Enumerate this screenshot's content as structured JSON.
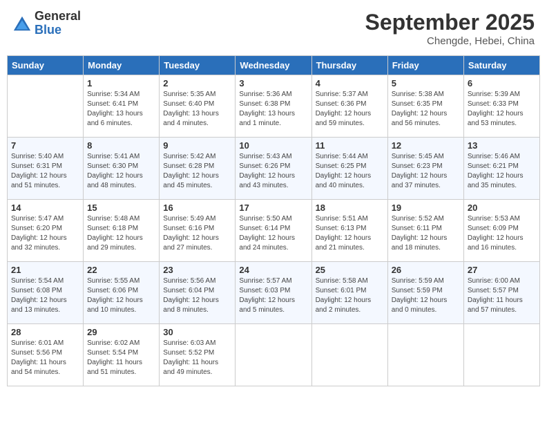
{
  "header": {
    "logo_general": "General",
    "logo_blue": "Blue",
    "month_title": "September 2025",
    "subtitle": "Chengde, Hebei, China"
  },
  "weekdays": [
    "Sunday",
    "Monday",
    "Tuesday",
    "Wednesday",
    "Thursday",
    "Friday",
    "Saturday"
  ],
  "weeks": [
    [
      {
        "day": "",
        "sunrise": "",
        "sunset": "",
        "daylight": ""
      },
      {
        "day": "1",
        "sunrise": "Sunrise: 5:34 AM",
        "sunset": "Sunset: 6:41 PM",
        "daylight": "Daylight: 13 hours and 6 minutes."
      },
      {
        "day": "2",
        "sunrise": "Sunrise: 5:35 AM",
        "sunset": "Sunset: 6:40 PM",
        "daylight": "Daylight: 13 hours and 4 minutes."
      },
      {
        "day": "3",
        "sunrise": "Sunrise: 5:36 AM",
        "sunset": "Sunset: 6:38 PM",
        "daylight": "Daylight: 13 hours and 1 minute."
      },
      {
        "day": "4",
        "sunrise": "Sunrise: 5:37 AM",
        "sunset": "Sunset: 6:36 PM",
        "daylight": "Daylight: 12 hours and 59 minutes."
      },
      {
        "day": "5",
        "sunrise": "Sunrise: 5:38 AM",
        "sunset": "Sunset: 6:35 PM",
        "daylight": "Daylight: 12 hours and 56 minutes."
      },
      {
        "day": "6",
        "sunrise": "Sunrise: 5:39 AM",
        "sunset": "Sunset: 6:33 PM",
        "daylight": "Daylight: 12 hours and 53 minutes."
      }
    ],
    [
      {
        "day": "7",
        "sunrise": "Sunrise: 5:40 AM",
        "sunset": "Sunset: 6:31 PM",
        "daylight": "Daylight: 12 hours and 51 minutes."
      },
      {
        "day": "8",
        "sunrise": "Sunrise: 5:41 AM",
        "sunset": "Sunset: 6:30 PM",
        "daylight": "Daylight: 12 hours and 48 minutes."
      },
      {
        "day": "9",
        "sunrise": "Sunrise: 5:42 AM",
        "sunset": "Sunset: 6:28 PM",
        "daylight": "Daylight: 12 hours and 45 minutes."
      },
      {
        "day": "10",
        "sunrise": "Sunrise: 5:43 AM",
        "sunset": "Sunset: 6:26 PM",
        "daylight": "Daylight: 12 hours and 43 minutes."
      },
      {
        "day": "11",
        "sunrise": "Sunrise: 5:44 AM",
        "sunset": "Sunset: 6:25 PM",
        "daylight": "Daylight: 12 hours and 40 minutes."
      },
      {
        "day": "12",
        "sunrise": "Sunrise: 5:45 AM",
        "sunset": "Sunset: 6:23 PM",
        "daylight": "Daylight: 12 hours and 37 minutes."
      },
      {
        "day": "13",
        "sunrise": "Sunrise: 5:46 AM",
        "sunset": "Sunset: 6:21 PM",
        "daylight": "Daylight: 12 hours and 35 minutes."
      }
    ],
    [
      {
        "day": "14",
        "sunrise": "Sunrise: 5:47 AM",
        "sunset": "Sunset: 6:20 PM",
        "daylight": "Daylight: 12 hours and 32 minutes."
      },
      {
        "day": "15",
        "sunrise": "Sunrise: 5:48 AM",
        "sunset": "Sunset: 6:18 PM",
        "daylight": "Daylight: 12 hours and 29 minutes."
      },
      {
        "day": "16",
        "sunrise": "Sunrise: 5:49 AM",
        "sunset": "Sunset: 6:16 PM",
        "daylight": "Daylight: 12 hours and 27 minutes."
      },
      {
        "day": "17",
        "sunrise": "Sunrise: 5:50 AM",
        "sunset": "Sunset: 6:14 PM",
        "daylight": "Daylight: 12 hours and 24 minutes."
      },
      {
        "day": "18",
        "sunrise": "Sunrise: 5:51 AM",
        "sunset": "Sunset: 6:13 PM",
        "daylight": "Daylight: 12 hours and 21 minutes."
      },
      {
        "day": "19",
        "sunrise": "Sunrise: 5:52 AM",
        "sunset": "Sunset: 6:11 PM",
        "daylight": "Daylight: 12 hours and 18 minutes."
      },
      {
        "day": "20",
        "sunrise": "Sunrise: 5:53 AM",
        "sunset": "Sunset: 6:09 PM",
        "daylight": "Daylight: 12 hours and 16 minutes."
      }
    ],
    [
      {
        "day": "21",
        "sunrise": "Sunrise: 5:54 AM",
        "sunset": "Sunset: 6:08 PM",
        "daylight": "Daylight: 12 hours and 13 minutes."
      },
      {
        "day": "22",
        "sunrise": "Sunrise: 5:55 AM",
        "sunset": "Sunset: 6:06 PM",
        "daylight": "Daylight: 12 hours and 10 minutes."
      },
      {
        "day": "23",
        "sunrise": "Sunrise: 5:56 AM",
        "sunset": "Sunset: 6:04 PM",
        "daylight": "Daylight: 12 hours and 8 minutes."
      },
      {
        "day": "24",
        "sunrise": "Sunrise: 5:57 AM",
        "sunset": "Sunset: 6:03 PM",
        "daylight": "Daylight: 12 hours and 5 minutes."
      },
      {
        "day": "25",
        "sunrise": "Sunrise: 5:58 AM",
        "sunset": "Sunset: 6:01 PM",
        "daylight": "Daylight: 12 hours and 2 minutes."
      },
      {
        "day": "26",
        "sunrise": "Sunrise: 5:59 AM",
        "sunset": "Sunset: 5:59 PM",
        "daylight": "Daylight: 12 hours and 0 minutes."
      },
      {
        "day": "27",
        "sunrise": "Sunrise: 6:00 AM",
        "sunset": "Sunset: 5:57 PM",
        "daylight": "Daylight: 11 hours and 57 minutes."
      }
    ],
    [
      {
        "day": "28",
        "sunrise": "Sunrise: 6:01 AM",
        "sunset": "Sunset: 5:56 PM",
        "daylight": "Daylight: 11 hours and 54 minutes."
      },
      {
        "day": "29",
        "sunrise": "Sunrise: 6:02 AM",
        "sunset": "Sunset: 5:54 PM",
        "daylight": "Daylight: 11 hours and 51 minutes."
      },
      {
        "day": "30",
        "sunrise": "Sunrise: 6:03 AM",
        "sunset": "Sunset: 5:52 PM",
        "daylight": "Daylight: 11 hours and 49 minutes."
      },
      {
        "day": "",
        "sunrise": "",
        "sunset": "",
        "daylight": ""
      },
      {
        "day": "",
        "sunrise": "",
        "sunset": "",
        "daylight": ""
      },
      {
        "day": "",
        "sunrise": "",
        "sunset": "",
        "daylight": ""
      },
      {
        "day": "",
        "sunrise": "",
        "sunset": "",
        "daylight": ""
      }
    ]
  ]
}
